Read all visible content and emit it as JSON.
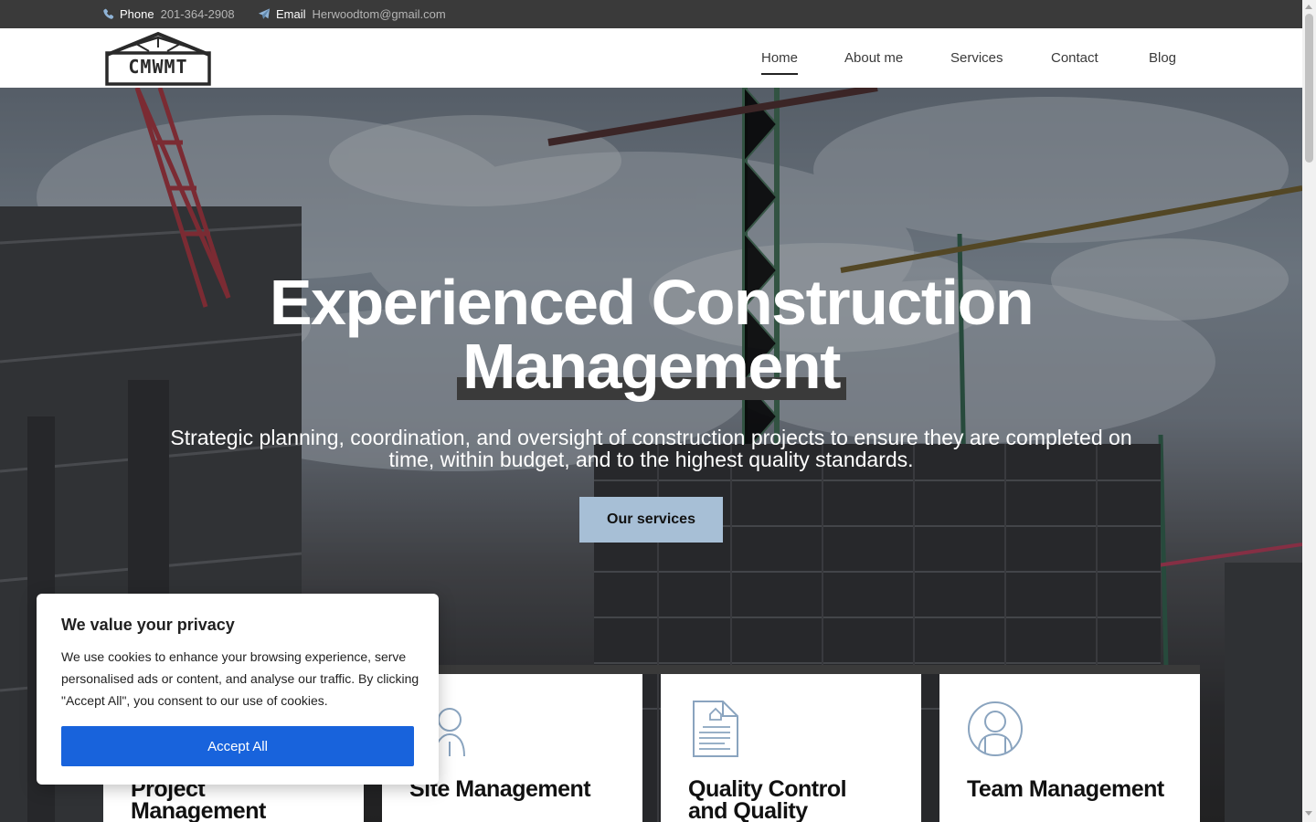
{
  "topbar": {
    "phone_label": "Phone",
    "phone_value": "201-364-2908",
    "phone_icon": "phone-icon",
    "email_label": "Email",
    "email_value": "Herwoodtom@gmail.com",
    "email_icon": "paper-plane-icon"
  },
  "header": {
    "logo_text": "CMWMT",
    "nav": [
      {
        "label": "Home",
        "active": true
      },
      {
        "label": "About me"
      },
      {
        "label": "Services"
      },
      {
        "label": "Contact"
      },
      {
        "label": "Blog"
      }
    ]
  },
  "hero": {
    "title_line1": "Experienced Construction",
    "title_line2": "Management",
    "subtitle_line1": "Strategic planning, coordination, and oversight of construction projects to ensure they are completed on",
    "subtitle_line2": "time, within budget, and to the highest quality standards.",
    "cta_label": "Our services"
  },
  "services": [
    {
      "title_line1": "Project",
      "title_line2": "Management",
      "icon": "project-icon"
    },
    {
      "title_line1": "Site Management",
      "title_line2": "",
      "icon": "worker-icon"
    },
    {
      "title_line1": "Quality Control",
      "title_line2": "and Quality",
      "icon": "document-icon"
    },
    {
      "title_line1": "Team Management",
      "title_line2": "",
      "icon": "person-icon"
    }
  ],
  "cookie": {
    "title": "We value your privacy",
    "text": "We use cookies to enhance your browsing experience, serve personalised ads or content, and analyse our traffic. By clicking \"Accept All\", you consent to our use of cookies.",
    "accept_label": "Accept All"
  },
  "colors": {
    "topbar_bg": "#3a3a3a",
    "cta_bg": "#a7bfd6",
    "accept_bg": "#1863dc",
    "icon_stroke": "#8aa4bf"
  }
}
